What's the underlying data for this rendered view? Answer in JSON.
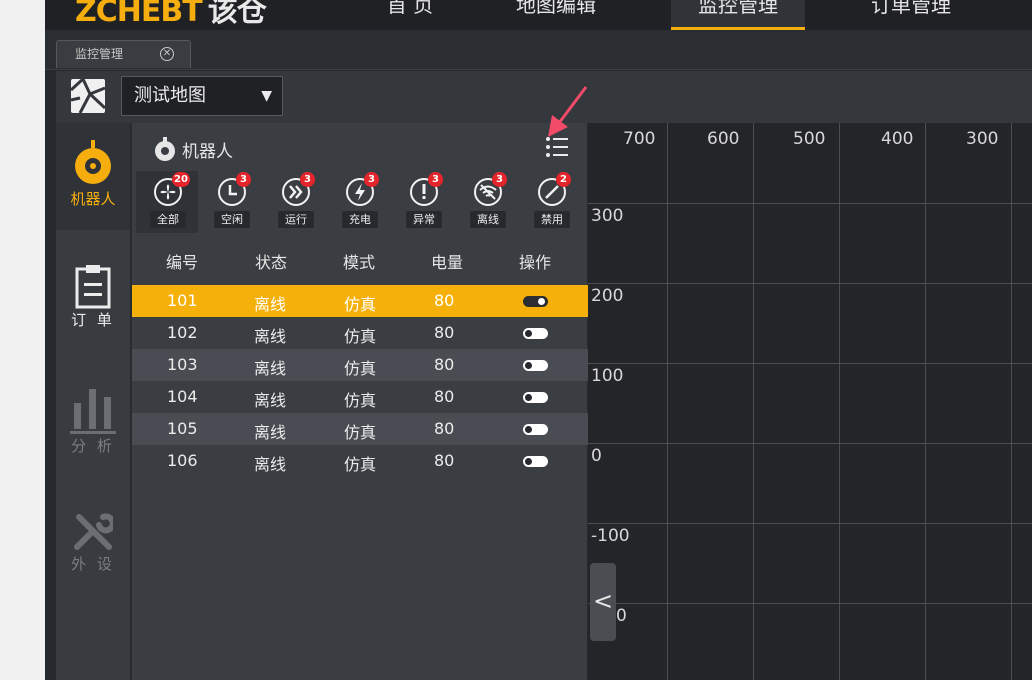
{
  "app": {
    "logo_text": "ZCHEBT",
    "logo_cn": "该仓"
  },
  "nav": {
    "items": [
      {
        "label": "首 页",
        "active": false
      },
      {
        "label": "地图编辑",
        "active": false
      },
      {
        "label": "监控管理",
        "active": true
      },
      {
        "label": "订单管理",
        "active": false
      }
    ]
  },
  "tabs": [
    {
      "label": "监控管理",
      "closable": true
    }
  ],
  "toolbar": {
    "map_select_value": "测试地图"
  },
  "rail": {
    "items": [
      {
        "label": "机器人",
        "icon": "robot-icon",
        "active": true
      },
      {
        "label": "订 单",
        "icon": "clipboard-icon",
        "active": false
      },
      {
        "label": "分 析",
        "icon": "bar-chart-icon",
        "active": false
      },
      {
        "label": "外 设",
        "icon": "tools-icon",
        "active": false
      }
    ]
  },
  "panel": {
    "title": "机器人",
    "filters": [
      {
        "label": "全部",
        "count": "20",
        "icon": "fan-icon"
      },
      {
        "label": "空闲",
        "count": "3",
        "icon": "clock-icon"
      },
      {
        "label": "运行",
        "count": "3",
        "icon": "fast-forward-icon"
      },
      {
        "label": "充电",
        "count": "3",
        "icon": "lightning-icon"
      },
      {
        "label": "异常",
        "count": "3",
        "icon": "exclamation-icon"
      },
      {
        "label": "离线",
        "count": "3",
        "icon": "wifi-off-icon"
      },
      {
        "label": "禁用",
        "count": "2",
        "icon": "ban-icon"
      }
    ],
    "table": {
      "columns": [
        "编号",
        "状态",
        "模式",
        "电量",
        "操作"
      ],
      "rows": [
        {
          "id": "101",
          "status": "离线",
          "mode": "仿真",
          "battery": "80",
          "enabled": true,
          "selected": true
        },
        {
          "id": "102",
          "status": "离线",
          "mode": "仿真",
          "battery": "80",
          "enabled": false,
          "selected": false
        },
        {
          "id": "103",
          "status": "离线",
          "mode": "仿真",
          "battery": "80",
          "enabled": false,
          "selected": false
        },
        {
          "id": "104",
          "status": "离线",
          "mode": "仿真",
          "battery": "80",
          "enabled": false,
          "selected": false
        },
        {
          "id": "105",
          "status": "离线",
          "mode": "仿真",
          "battery": "80",
          "enabled": false,
          "selected": false
        },
        {
          "id": "106",
          "status": "离线",
          "mode": "仿真",
          "battery": "80",
          "enabled": false,
          "selected": false
        }
      ]
    }
  },
  "map": {
    "x_labels": [
      "700",
      "600",
      "500",
      "400",
      "300"
    ],
    "y_labels": [
      "300",
      "200",
      "100",
      "0",
      "-100",
      "0"
    ]
  },
  "colors": {
    "accent": "#f6b00a",
    "badge": "#e5242b",
    "annotation": "#f24b6a"
  }
}
